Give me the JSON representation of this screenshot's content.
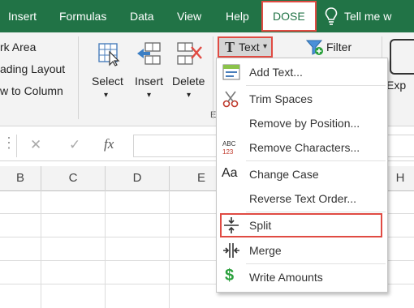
{
  "tabs": {
    "insert": "Insert",
    "formulas": "Formulas",
    "data": "Data",
    "view": "View",
    "help": "Help",
    "dose": "DOSE",
    "tell_me": "Tell me w"
  },
  "ribbon": {
    "work_area": "rk Area",
    "reading_layout": "ading Layout",
    "row_to_column": "w to Column",
    "select": "Select",
    "insert": "Insert",
    "delete": "Delete",
    "text": "Text",
    "filter": "Filter",
    "exp": "Exp",
    "group_partial": "E"
  },
  "formula_bar": {
    "cancel": "✕",
    "enter": "✓",
    "fx": "fx"
  },
  "columns": [
    "B",
    "C",
    "D",
    "E",
    "H"
  ],
  "menu": {
    "items": [
      {
        "label": "Add Text...",
        "icon": "add-text-icon"
      },
      {
        "label": "Trim Spaces",
        "icon": "scissors-icon"
      },
      {
        "label": "Remove by Position...",
        "icon": "none"
      },
      {
        "label": "Remove Characters...",
        "icon": "abc-123-icon"
      },
      {
        "label": "Change Case",
        "icon": "aa-icon"
      },
      {
        "label": "Reverse Text Order...",
        "icon": "none"
      },
      {
        "label": "Split",
        "icon": "split-icon"
      },
      {
        "label": "Merge",
        "icon": "merge-icon"
      },
      {
        "label": "Write Amounts",
        "icon": "dollar-icon"
      }
    ]
  },
  "colors": {
    "ribbon_green": "#217346",
    "highlight_red": "#e04b43",
    "dollar_green": "#2aa03c"
  }
}
